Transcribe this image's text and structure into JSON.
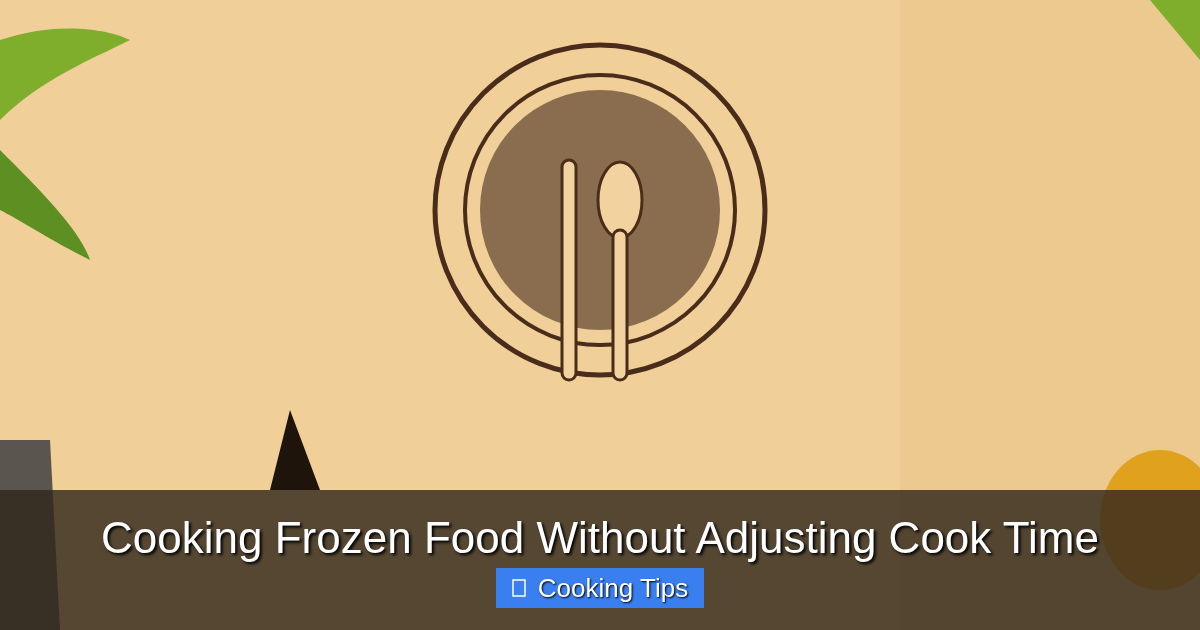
{
  "title": "Cooking Frozen Food Without Adjusting Cook Time",
  "category": {
    "label": "Cooking Tips"
  }
}
